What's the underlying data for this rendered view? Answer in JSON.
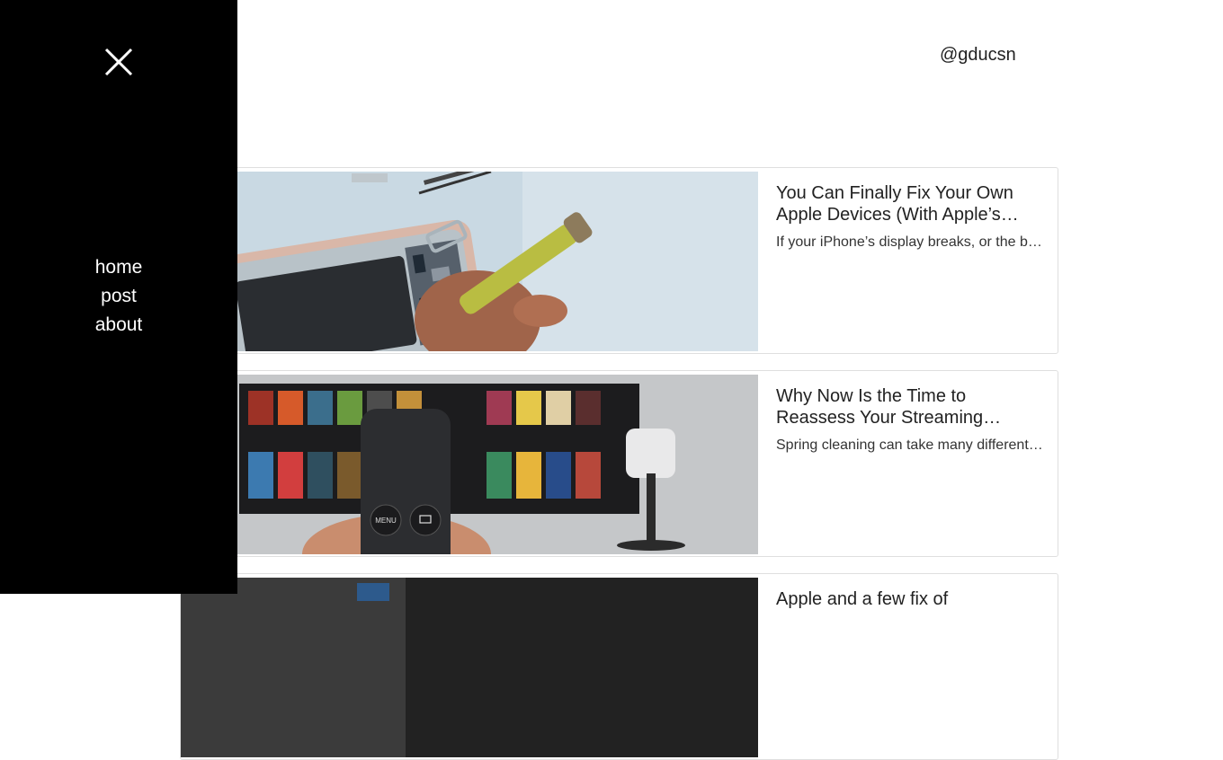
{
  "header": {
    "handle": "@gducsn"
  },
  "sidebar": {
    "close_icon": "close-icon",
    "nav": [
      {
        "label": "home"
      },
      {
        "label": "post"
      },
      {
        "label": "about"
      }
    ]
  },
  "posts": [
    {
      "title": "You Can Finally Fix Your Own Apple Devices (With Apple’s Help)",
      "excerpt": "If your iPhone’s display breaks, or the battery stops holding a charge"
    },
    {
      "title": "Why Now Is the Time to Reassess Your Streaming Services",
      "excerpt": "Spring cleaning can take many different forms"
    },
    {
      "title": "Apple and a few fix of",
      "excerpt": ""
    }
  ]
}
